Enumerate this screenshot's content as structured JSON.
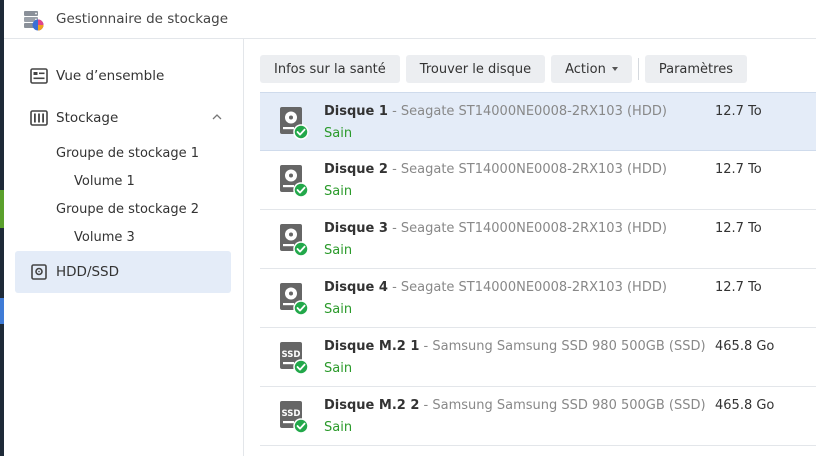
{
  "app": {
    "title": "Gestionnaire de stockage"
  },
  "sidebar": {
    "items": [
      {
        "label": "Vue d’ensemble"
      },
      {
        "label": "Stockage"
      },
      {
        "label": "HDD/SSD"
      }
    ],
    "storage_groups": [
      {
        "label": "Groupe de stockage 1",
        "volume": "Volume 1"
      },
      {
        "label": "Groupe de stockage 2",
        "volume": "Volume 3"
      }
    ]
  },
  "toolbar": {
    "health": "Infos sur la santé",
    "find": "Trouver le disque",
    "action": "Action",
    "settings": "Paramètres"
  },
  "disks": [
    {
      "name": "Disque 1",
      "desc": " - Seagate ST14000NE0008-2RX103 (HDD)",
      "status": "Sain",
      "size": "12.7 To",
      "kind": "hdd"
    },
    {
      "name": "Disque 2",
      "desc": " - Seagate ST14000NE0008-2RX103 (HDD)",
      "status": "Sain",
      "size": "12.7 To",
      "kind": "hdd"
    },
    {
      "name": "Disque 3",
      "desc": " - Seagate ST14000NE0008-2RX103 (HDD)",
      "status": "Sain",
      "size": "12.7 To",
      "kind": "hdd"
    },
    {
      "name": "Disque 4",
      "desc": " - Seagate ST14000NE0008-2RX103 (HDD)",
      "status": "Sain",
      "size": "12.7 To",
      "kind": "hdd"
    },
    {
      "name": "Disque M.2 1",
      "desc": " - Samsung Samsung SSD 980 500GB (SSD)",
      "status": "Sain",
      "size": "465.8 Go",
      "kind": "ssd",
      "badge": "SSD"
    },
    {
      "name": "Disque M.2 2",
      "desc": " - Samsung Samsung SSD 980 500GB (SSD)",
      "status": "Sain",
      "size": "465.8 Go",
      "kind": "ssd",
      "badge": "SSD"
    }
  ],
  "colors": {
    "accent_bg": "#e4ecf8",
    "healthy": "#2b9a2b",
    "check": "#22a84a"
  }
}
